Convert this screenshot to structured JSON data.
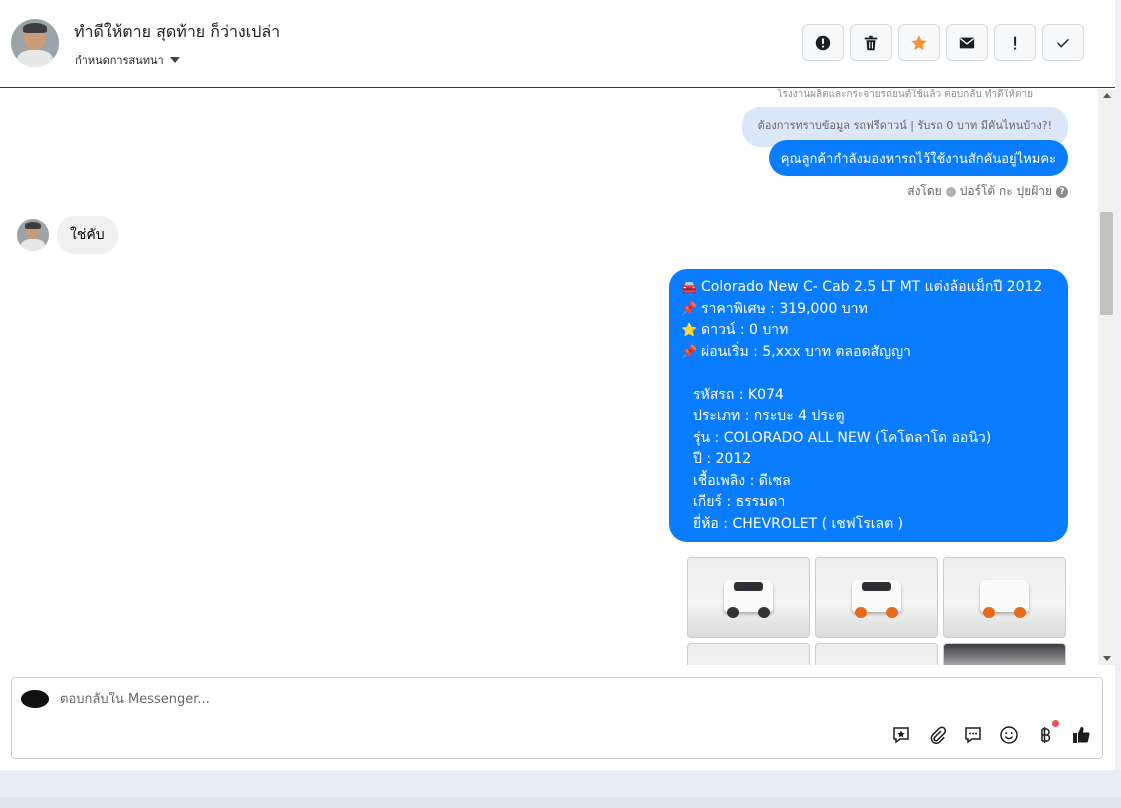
{
  "header": {
    "contact_name": "ทำดีให้ตาย สุดท้าย ก็ว่างเปล่า",
    "assign_label": "กำหนดการสนทนา",
    "tools": [
      {
        "name": "report-icon",
        "color": "#1c1e21"
      },
      {
        "name": "trash-icon",
        "color": "#1c1e21"
      },
      {
        "name": "star-icon",
        "color": "#f7923b"
      },
      {
        "name": "envelope-icon",
        "color": "#1c1e21"
      },
      {
        "name": "exclamation-icon",
        "color": "#1c1e21"
      },
      {
        "name": "check-icon",
        "color": "#1c1e21"
      }
    ]
  },
  "conversation": {
    "reply_reference": "โรงงานผลิตและกระจายรถยนต์ใช้แล้ว ตอบกลับ ทำดีให้ตาย",
    "quoted_message": "ต้องการทราบข้อมูล รถฟรีดาวน์ | รับรถ 0 บาท มีคันไหนบ้าง?!",
    "outgoing_question": "คุณลูกค้ากำลังมองหารถไว้ใช้งานสักคันอยู่ไหมคะ",
    "sent_by_label": "ส่งโดย",
    "sent_by_name": "ปอร์โต้ กะ ปุยฝ้าย",
    "incoming_reply": "ใช่คับ",
    "listing": {
      "line1": "Colorado New C- Cab 2.5 LT MT แต่งล้อแม็กปี 2012",
      "line2": "ราคาพิเศษ : 319,000 บาท",
      "line3": "ดาวน์ : 0 บาท",
      "line4": "ผ่อนเริ่ม : 5,xxx บาท ตลอดสัญญา",
      "code": "รหัสรถ : K074",
      "type": "ประเภท : กระบะ 4 ประตู",
      "model": "รุ่น : COLORADO ALL NEW (โคโดลาโด ออนิว)",
      "year": "ปี : 2012",
      "fuel": "เชื้อเพลิง : ดีเซล",
      "gear": "เกียร์ : ธรรมดา",
      "brand": "ยี่ห้อ : CHEVROLET ( เชฟโรเลต )"
    },
    "photos": [
      {
        "name": "car-photo-front"
      },
      {
        "name": "car-photo-front-angle"
      },
      {
        "name": "car-photo-rear"
      },
      {
        "name": "car-photo-4"
      },
      {
        "name": "car-photo-5"
      },
      {
        "name": "car-photo-6"
      }
    ]
  },
  "composer": {
    "placeholder": "ตอบกลับใน Messenger...",
    "icons": [
      "saved-reply-icon",
      "attachment-icon",
      "quick-reply-icon",
      "emoji-icon",
      "baht-payment-icon",
      "like-icon"
    ]
  },
  "colors": {
    "outgoing_bubble": "#0a7cff",
    "quoted_bubble": "#dbe7f9",
    "incoming_bubble": "#f0f0f0",
    "star": "#f7923b"
  }
}
